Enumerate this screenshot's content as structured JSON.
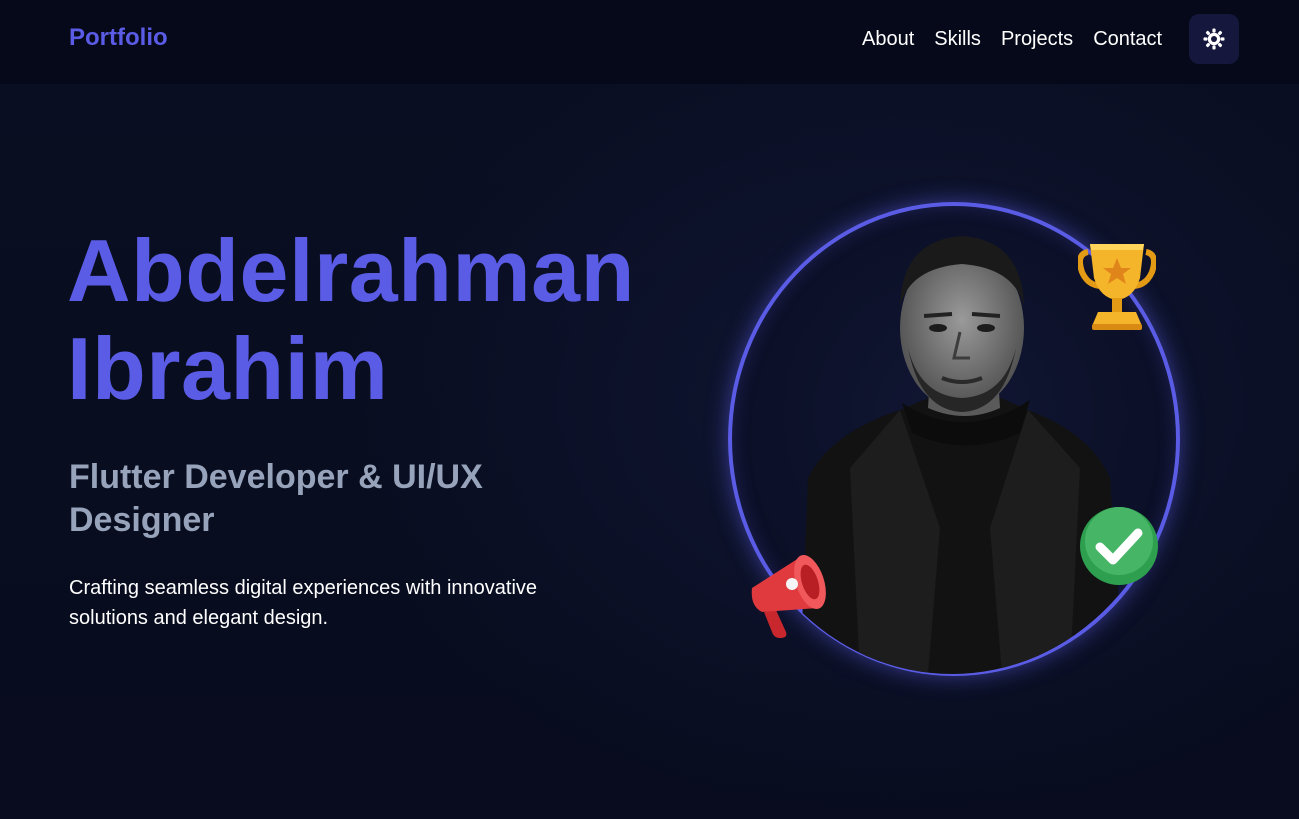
{
  "header": {
    "brand": "Portfolio",
    "nav": [
      {
        "label": "About"
      },
      {
        "label": "Skills"
      },
      {
        "label": "Projects"
      },
      {
        "label": "Contact"
      }
    ],
    "theme_toggle_icon": "sun-gear-icon"
  },
  "hero": {
    "name_line1": "Abdelrahman",
    "name_line2": "Ibrahim",
    "role": "Flutter Developer & UI/UX Designer",
    "tagline": "Crafting seamless digital experiences with innovative solutions and elegant design."
  },
  "portrait": {
    "badges": [
      "trophy-icon",
      "check-icon",
      "megaphone-icon"
    ]
  },
  "colors": {
    "accent": "#5b5ce6",
    "background": "#0a0e22",
    "header_bg": "#050919",
    "role_text": "#97a3ba",
    "check_green": "#2e9e4f",
    "megaphone_red": "#e0393e",
    "trophy_gold": "#f4b52b"
  }
}
